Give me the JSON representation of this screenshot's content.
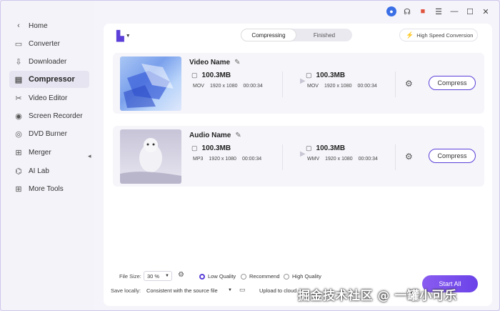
{
  "sidebar": {
    "items": [
      {
        "label": "Home",
        "icon": "back-arrow-icon",
        "glyph": "‹"
      },
      {
        "label": "Converter",
        "icon": "converter-icon",
        "glyph": "▭"
      },
      {
        "label": "Downloader",
        "icon": "downloader-icon",
        "glyph": "⇩"
      },
      {
        "label": "Compressor",
        "icon": "compressor-icon",
        "glyph": "▤"
      },
      {
        "label": "Video Editor",
        "icon": "scissors-icon",
        "glyph": "✂"
      },
      {
        "label": "Screen Recorder",
        "icon": "screen-recorder-icon",
        "glyph": "◉"
      },
      {
        "label": "DVD Burner",
        "icon": "dvd-icon",
        "glyph": "◎"
      },
      {
        "label": "Merger",
        "icon": "merger-icon",
        "glyph": "⊞"
      },
      {
        "label": "AI Lab",
        "icon": "ai-lab-icon",
        "glyph": "⌬"
      },
      {
        "label": "More Tools",
        "icon": "more-tools-icon",
        "glyph": "⊞"
      }
    ]
  },
  "toolbar": {
    "tabs": [
      "Compressing",
      "Finished"
    ],
    "high_speed_label": "High Speed Conversion"
  },
  "files": [
    {
      "name": "Video Name",
      "source": {
        "size": "100.3MB",
        "format": "MOV",
        "resolution": "1920 x 1080",
        "duration": "00:00:34"
      },
      "target": {
        "size": "100.3MB",
        "format": "MOV",
        "resolution": "1920 x 1080",
        "duration": "00:00:34"
      },
      "compress_label": "Compress"
    },
    {
      "name": "Audio Name",
      "source": {
        "size": "100.3MB",
        "format": "MP3",
        "resolution": "1920 x 1080",
        "duration": "00:00:34"
      },
      "target": {
        "size": "100.3MB",
        "format": "WMV",
        "resolution": "1920 x 1080",
        "duration": "00:00:34"
      },
      "compress_label": "Compress"
    }
  ],
  "bottom": {
    "file_size_label": "File Size:",
    "file_size_value": "30 %",
    "quality_options": [
      "Low Quality",
      "Recommend",
      "High Quality"
    ],
    "save_label": "Save locally:",
    "save_value": "Consistent with the source file",
    "upload_label": "Upload to cloud",
    "start_label": "Start All"
  },
  "watermark": "掘金技术社区 @ 一罐小可乐",
  "colors": {
    "accent": "#5b3fd8",
    "background": "#f5f4fa"
  }
}
